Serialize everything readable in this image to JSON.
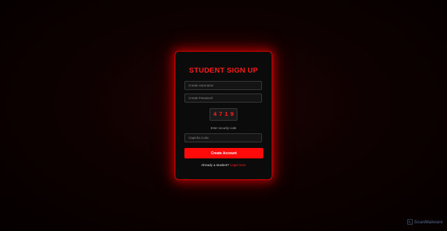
{
  "signup": {
    "title": "STUDENT SIGN UP",
    "username_placeholder": "Create Username",
    "password_placeholder": "Create Password",
    "captcha_code": "4719",
    "captcha_hint": "Enter security code",
    "captcha_placeholder": "Captcha Code",
    "submit_label": "Create Account",
    "already_text": "Already a student?",
    "login_link": "Login here"
  },
  "watermark": {
    "text": "ScanMalware",
    "icon": "scanmalware-logo-icon"
  },
  "colors": {
    "accent": "#ff0a0a",
    "card_background": "#0b0b0b",
    "page_background": "#0e0101"
  }
}
